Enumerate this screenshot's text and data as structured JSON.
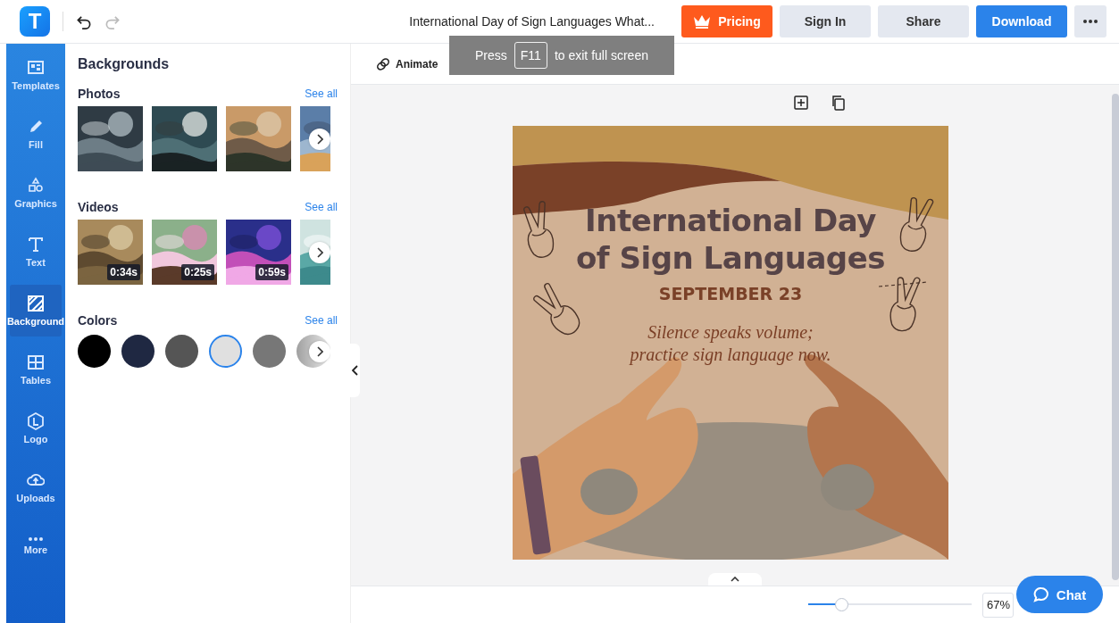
{
  "header": {
    "logo": "T",
    "title": "International Day of Sign Languages What...",
    "buttons": [
      {
        "kind": "pricing",
        "label": "Pricing"
      },
      {
        "kind": "secondary",
        "label": "Sign In"
      },
      {
        "kind": "secondary",
        "label": "Share"
      },
      {
        "kind": "primary",
        "label": "Download"
      },
      {
        "kind": "more"
      }
    ]
  },
  "fullscreen_notice": {
    "before": "Press",
    "key": "F11",
    "after": "to exit full screen"
  },
  "nav": [
    {
      "kind": "templates",
      "label": "Templates",
      "selected": false
    },
    {
      "kind": "fill",
      "label": "Fill",
      "selected": false
    },
    {
      "kind": "graphics",
      "label": "Graphics",
      "selected": false
    },
    {
      "kind": "text",
      "label": "Text",
      "selected": false
    },
    {
      "kind": "background",
      "label": "Background",
      "selected": true
    },
    {
      "kind": "tables",
      "label": "Tables",
      "selected": false
    },
    {
      "kind": "logo",
      "label": "Logo",
      "selected": false
    },
    {
      "kind": "uploads",
      "label": "Uploads",
      "selected": false
    },
    {
      "kind": "more",
      "label": "More",
      "selected": false
    }
  ],
  "panel": {
    "title": "Backgrounds",
    "photos": {
      "title": "Photos",
      "link": "See all",
      "items": [
        {
          "kind": "picture"
        },
        {
          "kind": "picture"
        },
        {
          "kind": "picture"
        },
        {
          "kind": "picture"
        }
      ]
    },
    "videos": {
      "title": "Videos",
      "link": "See all",
      "items": [
        {
          "kind": "picture",
          "duration": "0:34s"
        },
        {
          "kind": "picture",
          "duration": "0:25s"
        },
        {
          "kind": "picture",
          "duration": "0:59s"
        },
        {
          "kind": "picture"
        }
      ]
    },
    "colors": {
      "title": "Colors",
      "link": "See all",
      "items": [
        {
          "color": "#000000",
          "selected": false
        },
        {
          "color": "#1f2842",
          "selected": false
        },
        {
          "color": "#555555",
          "selected": false
        },
        {
          "color": "#e0e0e0",
          "selected": true
        },
        {
          "color": "#777777",
          "selected": false
        },
        {
          "color": "#a0a0a0",
          "selected": false
        }
      ]
    }
  },
  "toolbar": {
    "animate": "Animate"
  },
  "design": {
    "title_lines": [
      "International Day",
      "of Sign Languages"
    ],
    "date": "SEPTEMBER 23",
    "tagline_lines": [
      "Silence speaks volume;",
      "practice sign language now."
    ]
  },
  "footer": {
    "zoom": {
      "level": 0.2,
      "value": "67%"
    },
    "chat": "Chat"
  }
}
